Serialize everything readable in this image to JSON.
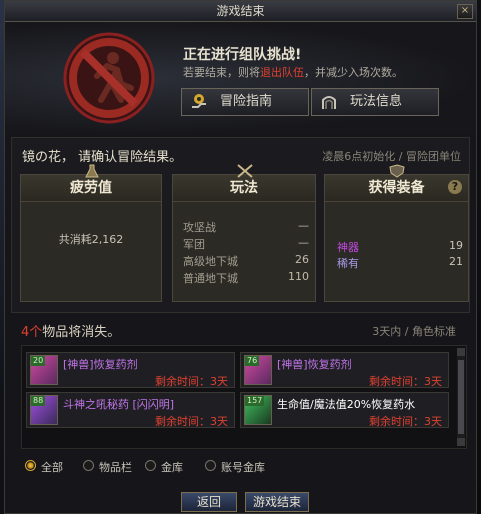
{
  "window": {
    "title": "游戏结束",
    "close_label": "×"
  },
  "header": {
    "headline": "正在进行组队挑战!",
    "sub_before": "若要结束，则将",
    "sub_highlight": "退出队伍",
    "sub_after": "，并减少入场次数。"
  },
  "buttons": {
    "guide": "冒险指南",
    "info": "玩法信息",
    "back": "返回",
    "end_game": "游戏结束"
  },
  "summary": {
    "title": "镜の花， 请确认冒险结果。",
    "note": "凌晨6点初始化 / 冒险团单位",
    "fatigue": {
      "title": "疲劳值",
      "text": "共消耗2,162"
    },
    "play": {
      "title": "玩法",
      "rows": [
        {
          "label": "攻坚战",
          "value": "—"
        },
        {
          "label": "军团",
          "value": "—"
        },
        {
          "label": "高级地下城",
          "value": "26"
        },
        {
          "label": "普通地下城",
          "value": "110"
        }
      ]
    },
    "equipment": {
      "title": "获得装备",
      "help": "?",
      "rows": [
        {
          "label": "神器",
          "value": "19",
          "color": "#c04ae0"
        },
        {
          "label": "稀有",
          "value": "21",
          "color": "#a89ae8"
        }
      ]
    }
  },
  "vanish": {
    "count": "4个",
    "text": "物品将消失。",
    "note": "3天内 / 角色标准",
    "items": [
      {
        "badge": "20",
        "name": "[神兽]恢复药剂",
        "name_color": "#c074e8",
        "time_label": "剩余时间：",
        "time": "3天",
        "icon_color": "#d04aa0"
      },
      {
        "badge": "76",
        "name": "[神兽]恢复药剂",
        "name_color": "#c074e8",
        "time_label": "剩余时间：",
        "time": "3天",
        "icon_color": "#d04aa0"
      },
      {
        "badge": "88",
        "name": "斗神之吼秘药 [闪闪明]",
        "name_color": "#c074e8",
        "time_label": "剩余时间：",
        "time": "3天",
        "icon_color": "#a050e0"
      },
      {
        "badge": "157",
        "name": "生命值/魔法值20%恢复药水",
        "name_color": "#ffffff",
        "time_label": "剩余时间：",
        "time": "3天",
        "icon_color": "#40c060"
      }
    ]
  },
  "filters": [
    "全部",
    "物品栏",
    "金库",
    "账号金库"
  ],
  "selected_filter": "全部"
}
